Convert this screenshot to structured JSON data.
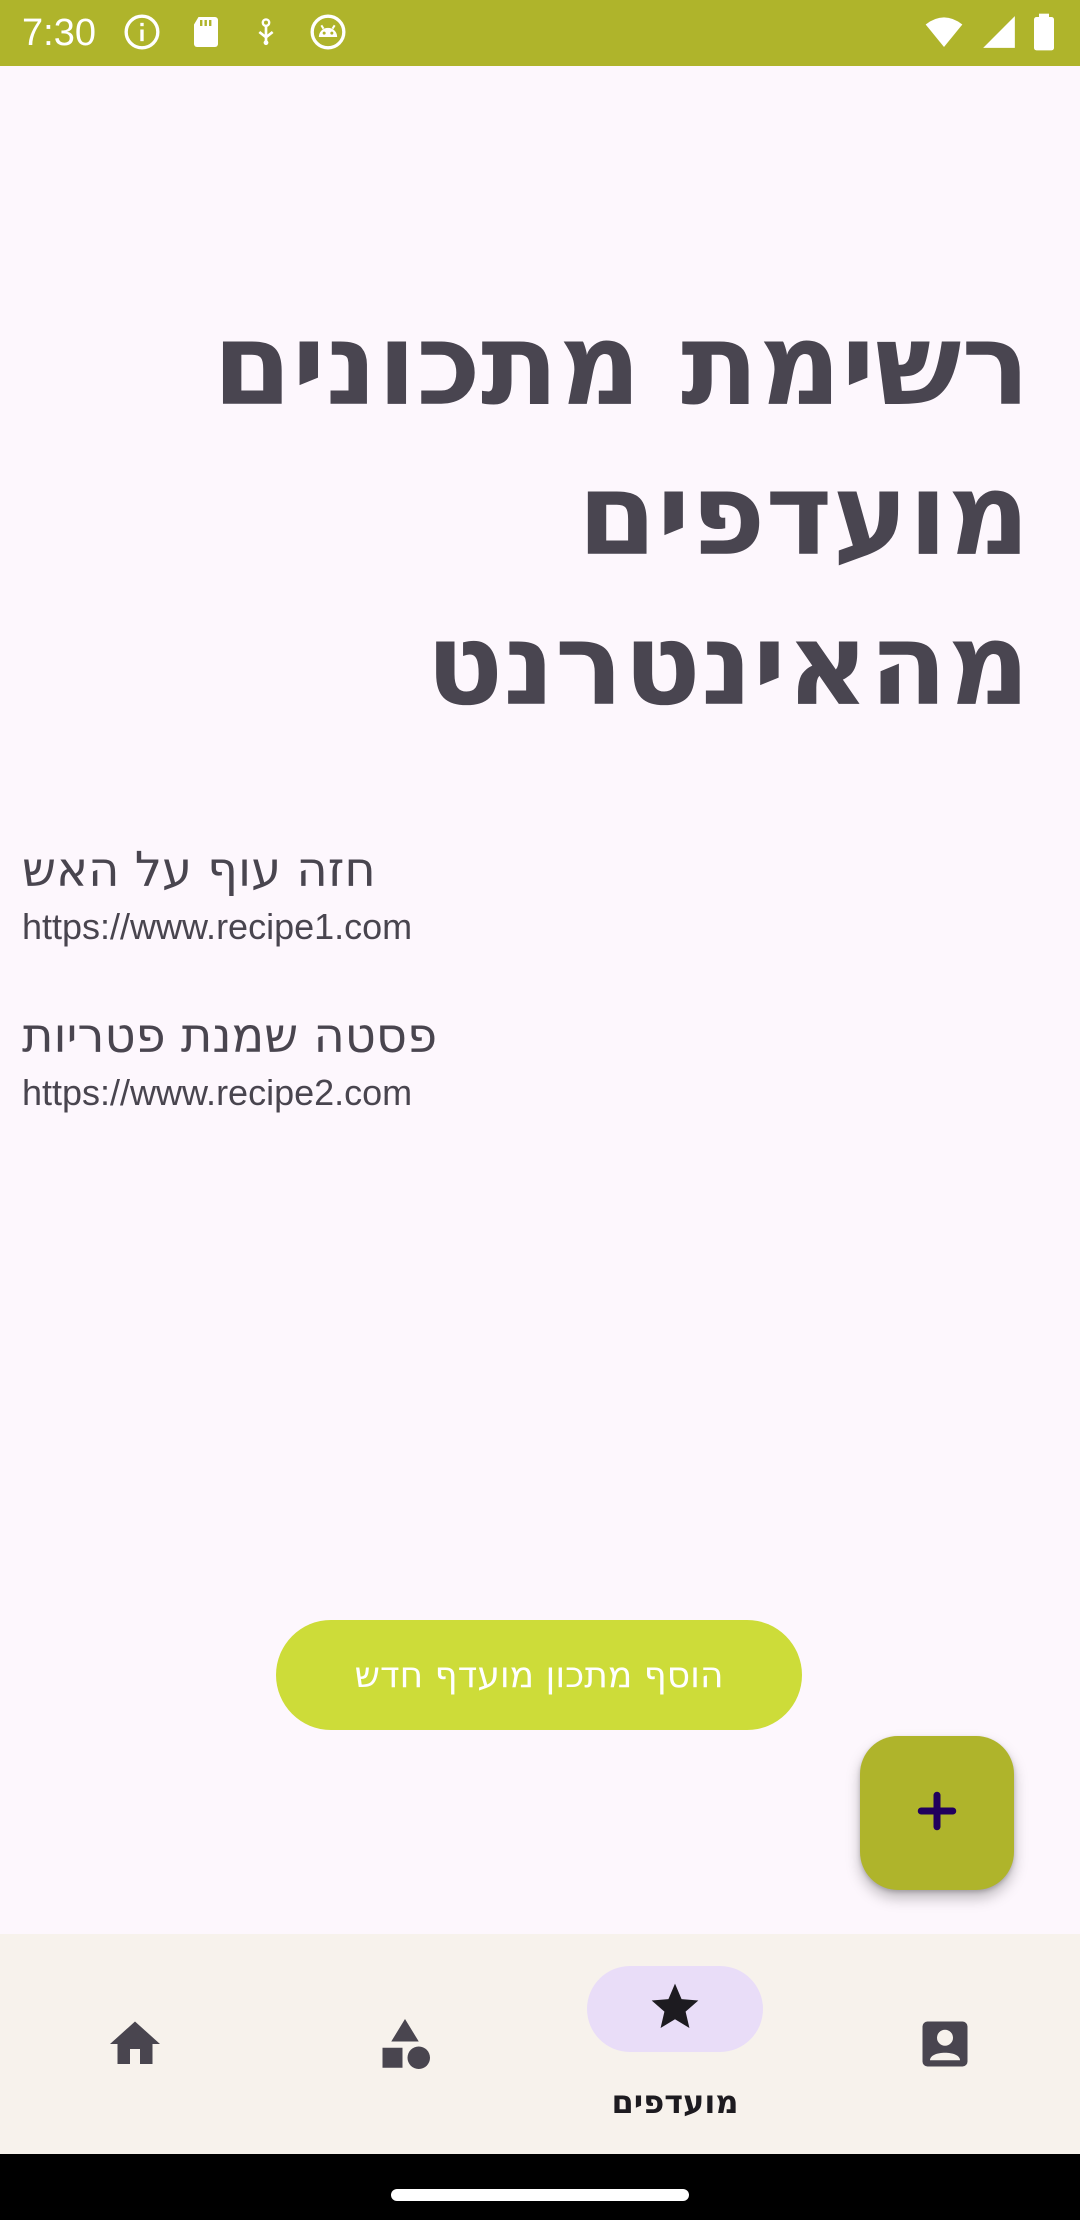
{
  "status_bar": {
    "time": "7:30",
    "left_icons": [
      "info-icon",
      "sd-card-icon",
      "usb-debug-icon",
      "android-icon"
    ],
    "right_icons": [
      "wifi-icon",
      "signal-icon",
      "battery-icon"
    ]
  },
  "page": {
    "title": "רשימת מתכונים מועדפים מהאינטרנט"
  },
  "recipes": [
    {
      "name": "חזה עוף על האש",
      "url": "https://www.recipe1.com"
    },
    {
      "name": "פסטה שמנת פטריות",
      "url": "https://www.recipe2.com"
    }
  ],
  "actions": {
    "add_button_label": "הוסף מתכון מועדף חדש",
    "fab_icon": "plus-icon"
  },
  "bottom_nav": {
    "items": [
      {
        "id": "home",
        "icon": "home-icon",
        "label": "",
        "selected": false
      },
      {
        "id": "categories",
        "icon": "shapes-icon",
        "label": "",
        "selected": false
      },
      {
        "id": "favorites",
        "icon": "star-icon",
        "label": "מועדפים",
        "selected": true
      },
      {
        "id": "profile",
        "icon": "contact-icon",
        "label": "",
        "selected": false
      }
    ]
  },
  "colors": {
    "status_bar": "#afb42b",
    "background": "#fdf7fd",
    "add_button": "#cddc39",
    "fab": "#afb42b",
    "fab_icon": "#21005d",
    "nav_background": "#f7f2ec",
    "nav_indicator": "#e9ddf8",
    "text": "#49454f"
  }
}
